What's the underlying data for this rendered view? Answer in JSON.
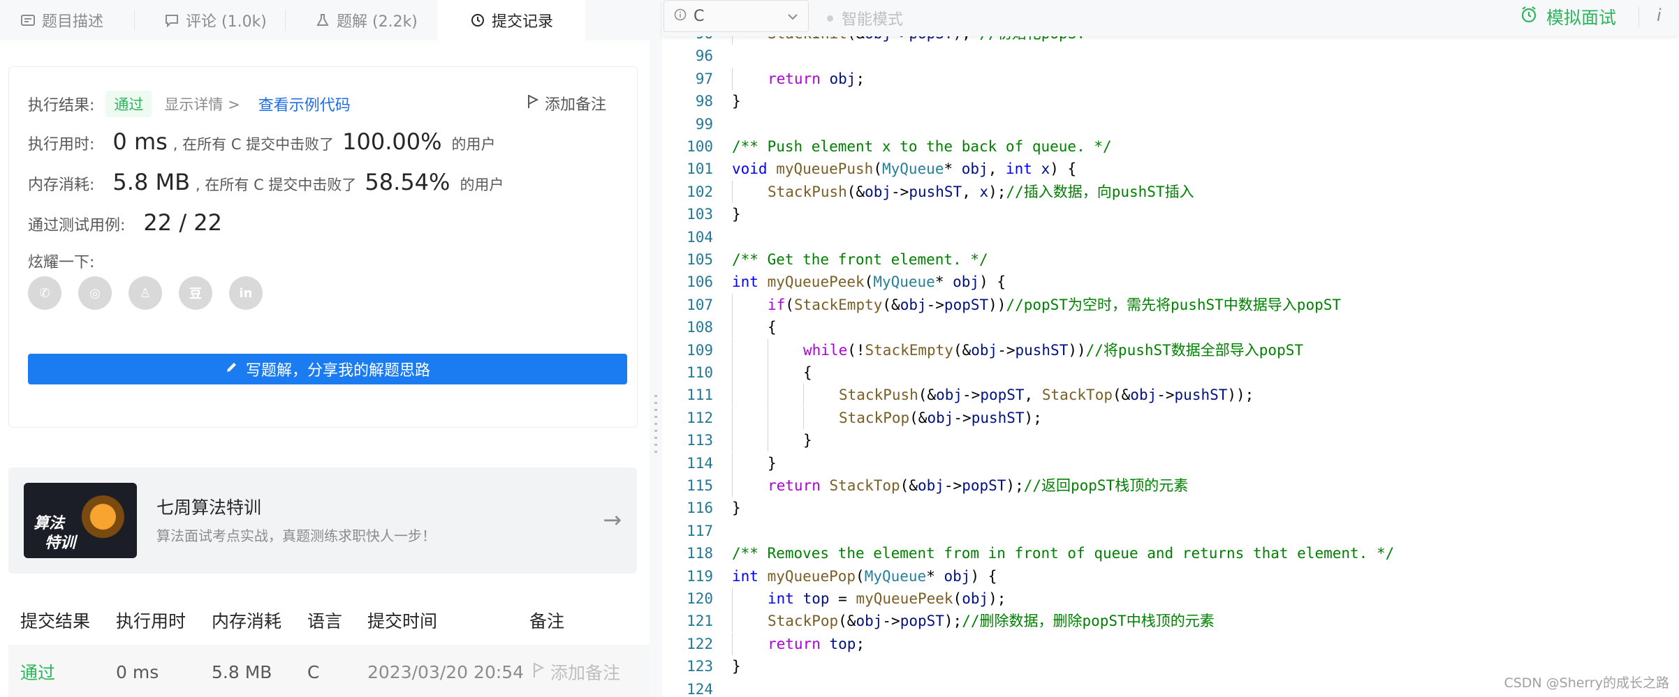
{
  "tabs": [
    {
      "label": "题目描述",
      "icon": "doc-icon"
    },
    {
      "label": "评论 (1.0k)",
      "icon": "comment-icon"
    },
    {
      "label": "题解 (2.2k)",
      "icon": "flask-icon"
    },
    {
      "label": "提交记录",
      "icon": "clock-icon"
    }
  ],
  "result": {
    "label": "执行结果:",
    "status": "通过",
    "detail": "显示详情 >",
    "example_link": "查看示例代码",
    "add_note": "添加备注"
  },
  "runtime": {
    "label": "执行用时:",
    "value": "0 ms",
    "mid": ", 在所有 C 提交中击败了",
    "percent": "100.00%",
    "tail": "的用户"
  },
  "memory": {
    "label": "内存消耗:",
    "value": "5.8 MB",
    "mid": ", 在所有 C 提交中击败了",
    "percent": "58.54%",
    "tail": "的用户"
  },
  "testcases": {
    "label": "通过测试用例:",
    "value": "22 / 22"
  },
  "share": {
    "label": "炫耀一下:",
    "icons": [
      "wechat-icon",
      "weibo-icon",
      "qq-icon",
      "douban-icon",
      "linkedin-icon"
    ],
    "glyphs": [
      "✆",
      "◎",
      "♙",
      "豆",
      "in"
    ]
  },
  "write_button": "写题解，分享我的解题思路",
  "promo": {
    "badge_line1": "算法",
    "badge_line2": "特训",
    "title": "七周算法特训",
    "subtitle": "算法面试考点实战，真题测练求职快人一步！"
  },
  "submissions": {
    "headers": [
      "提交结果",
      "执行用时",
      "内存消耗",
      "语言",
      "提交时间",
      "备注"
    ],
    "row": {
      "status": "通过",
      "runtime": "0 ms",
      "memory": "5.8 MB",
      "language": "C",
      "time": "2023/03/20 20:54",
      "note": "添加备注"
    }
  },
  "editor": {
    "language": "C",
    "smart_mode": "智能模式",
    "mock_interview": "模拟面试",
    "info": "i"
  },
  "code_lines": [
    {
      "n": "96",
      "indent": 1,
      "tokens": [
        [
          "fn",
          "StackInit"
        ],
        [
          "",
          "(&"
        ],
        [
          "var",
          "obj"
        ],
        [
          "",
          "->"
        ],
        [
          "var",
          "popST"
        ],
        [
          "",
          "); "
        ],
        [
          "cm",
          "//初始化popST"
        ]
      ]
    },
    {
      "n": "96",
      "indent": 0,
      "tokens": []
    },
    {
      "n": "97",
      "indent": 1,
      "tokens": [
        [
          "ctl",
          "return"
        ],
        [
          "",
          " "
        ],
        [
          "var",
          "obj"
        ],
        [
          "",
          ";"
        ]
      ]
    },
    {
      "n": "98",
      "indent": 0,
      "tokens": [
        [
          "",
          "}"
        ]
      ]
    },
    {
      "n": "99",
      "indent": 0,
      "tokens": []
    },
    {
      "n": "100",
      "indent": 0,
      "tokens": [
        [
          "cm",
          "/** Push element x to the back of queue. */"
        ]
      ]
    },
    {
      "n": "101",
      "indent": 0,
      "tokens": [
        [
          "kw",
          "void"
        ],
        [
          "",
          " "
        ],
        [
          "fn",
          "myQueuePush"
        ],
        [
          "",
          "("
        ],
        [
          "ty",
          "MyQueue"
        ],
        [
          "",
          "* "
        ],
        [
          "var",
          "obj"
        ],
        [
          "",
          ", "
        ],
        [
          "kw",
          "int"
        ],
        [
          "",
          " "
        ],
        [
          "var",
          "x"
        ],
        [
          "",
          ") {"
        ]
      ]
    },
    {
      "n": "102",
      "indent": 1,
      "tokens": [
        [
          "fn",
          "StackPush"
        ],
        [
          "",
          "(&"
        ],
        [
          "var",
          "obj"
        ],
        [
          "",
          "->"
        ],
        [
          "var",
          "pushST"
        ],
        [
          "",
          ", "
        ],
        [
          "var",
          "x"
        ],
        [
          "",
          ");"
        ],
        [
          "cm",
          "//插入数据，向pushST插入"
        ]
      ]
    },
    {
      "n": "103",
      "indent": 0,
      "tokens": [
        [
          "",
          "}"
        ]
      ]
    },
    {
      "n": "104",
      "indent": 0,
      "tokens": []
    },
    {
      "n": "105",
      "indent": 0,
      "tokens": [
        [
          "cm",
          "/** Get the front element. */"
        ]
      ]
    },
    {
      "n": "106",
      "indent": 0,
      "tokens": [
        [
          "kw",
          "int"
        ],
        [
          "",
          " "
        ],
        [
          "fn",
          "myQueuePeek"
        ],
        [
          "",
          "("
        ],
        [
          "ty",
          "MyQueue"
        ],
        [
          "",
          "* "
        ],
        [
          "var",
          "obj"
        ],
        [
          "",
          ") {"
        ]
      ]
    },
    {
      "n": "107",
      "indent": 1,
      "tokens": [
        [
          "ctl",
          "if"
        ],
        [
          "",
          "("
        ],
        [
          "fn",
          "StackEmpty"
        ],
        [
          "",
          "(&"
        ],
        [
          "var",
          "obj"
        ],
        [
          "",
          "->"
        ],
        [
          "var",
          "popST"
        ],
        [
          "",
          "))"
        ],
        [
          "cm",
          "//popST为空时，需先将pushST中数据导入popST"
        ]
      ]
    },
    {
      "n": "108",
      "indent": 1,
      "tokens": [
        [
          "",
          "{"
        ]
      ]
    },
    {
      "n": "109",
      "indent": 2,
      "tokens": [
        [
          "ctl",
          "while"
        ],
        [
          "",
          "(!"
        ],
        [
          "fn",
          "StackEmpty"
        ],
        [
          "",
          "(&"
        ],
        [
          "var",
          "obj"
        ],
        [
          "",
          "->"
        ],
        [
          "var",
          "pushST"
        ],
        [
          "",
          "))"
        ],
        [
          "cm",
          "//将pushST数据全部导入popST"
        ]
      ]
    },
    {
      "n": "110",
      "indent": 2,
      "tokens": [
        [
          "",
          "{"
        ]
      ]
    },
    {
      "n": "111",
      "indent": 3,
      "tokens": [
        [
          "fn",
          "StackPush"
        ],
        [
          "",
          "(&"
        ],
        [
          "var",
          "obj"
        ],
        [
          "",
          "->"
        ],
        [
          "var",
          "popST"
        ],
        [
          "",
          ", "
        ],
        [
          "fn",
          "StackTop"
        ],
        [
          "",
          "(&"
        ],
        [
          "var",
          "obj"
        ],
        [
          "",
          "->"
        ],
        [
          "var",
          "pushST"
        ],
        [
          "",
          "));"
        ]
      ]
    },
    {
      "n": "112",
      "indent": 3,
      "tokens": [
        [
          "fn",
          "StackPop"
        ],
        [
          "",
          "(&"
        ],
        [
          "var",
          "obj"
        ],
        [
          "",
          "->"
        ],
        [
          "var",
          "pushST"
        ],
        [
          "",
          ");"
        ]
      ]
    },
    {
      "n": "113",
      "indent": 2,
      "tokens": [
        [
          "",
          "}"
        ]
      ]
    },
    {
      "n": "114",
      "indent": 1,
      "tokens": [
        [
          "",
          "}"
        ]
      ]
    },
    {
      "n": "115",
      "indent": 1,
      "tokens": [
        [
          "ctl",
          "return"
        ],
        [
          "",
          " "
        ],
        [
          "fn",
          "StackTop"
        ],
        [
          "",
          "(&"
        ],
        [
          "var",
          "obj"
        ],
        [
          "",
          "->"
        ],
        [
          "var",
          "popST"
        ],
        [
          "",
          ");"
        ],
        [
          "cm",
          "//返回popST栈顶的元素"
        ]
      ]
    },
    {
      "n": "116",
      "indent": 0,
      "tokens": [
        [
          "",
          "}"
        ]
      ]
    },
    {
      "n": "117",
      "indent": 0,
      "tokens": []
    },
    {
      "n": "118",
      "indent": 0,
      "tokens": [
        [
          "cm",
          "/** Removes the element from in front of queue and returns that element. */"
        ]
      ]
    },
    {
      "n": "119",
      "indent": 0,
      "tokens": [
        [
          "kw",
          "int"
        ],
        [
          "",
          " "
        ],
        [
          "fn",
          "myQueuePop"
        ],
        [
          "",
          "("
        ],
        [
          "ty",
          "MyQueue"
        ],
        [
          "",
          "* "
        ],
        [
          "var",
          "obj"
        ],
        [
          "",
          ") {"
        ]
      ]
    },
    {
      "n": "120",
      "indent": 1,
      "tokens": [
        [
          "kw",
          "int"
        ],
        [
          "",
          " "
        ],
        [
          "var",
          "top"
        ],
        [
          "",
          " = "
        ],
        [
          "fn",
          "myQueuePeek"
        ],
        [
          "",
          "("
        ],
        [
          "var",
          "obj"
        ],
        [
          "",
          ");"
        ]
      ]
    },
    {
      "n": "121",
      "indent": 1,
      "tokens": [
        [
          "fn",
          "StackPop"
        ],
        [
          "",
          "(&"
        ],
        [
          "var",
          "obj"
        ],
        [
          "",
          "->"
        ],
        [
          "var",
          "popST"
        ],
        [
          "",
          ");"
        ],
        [
          "cm",
          "//删除数据，删除popST中栈顶的元素"
        ]
      ]
    },
    {
      "n": "122",
      "indent": 1,
      "tokens": [
        [
          "ctl",
          "return"
        ],
        [
          "",
          " "
        ],
        [
          "var",
          "top"
        ],
        [
          "",
          ";"
        ]
      ]
    },
    {
      "n": "123",
      "indent": 0,
      "tokens": [
        [
          "",
          "}"
        ]
      ]
    },
    {
      "n": "124",
      "indent": 0,
      "tokens": []
    }
  ],
  "watermark": "CSDN @Sherry的成长之路",
  "colors": {
    "accent": "#1a7cf0",
    "success": "#2db55d"
  }
}
